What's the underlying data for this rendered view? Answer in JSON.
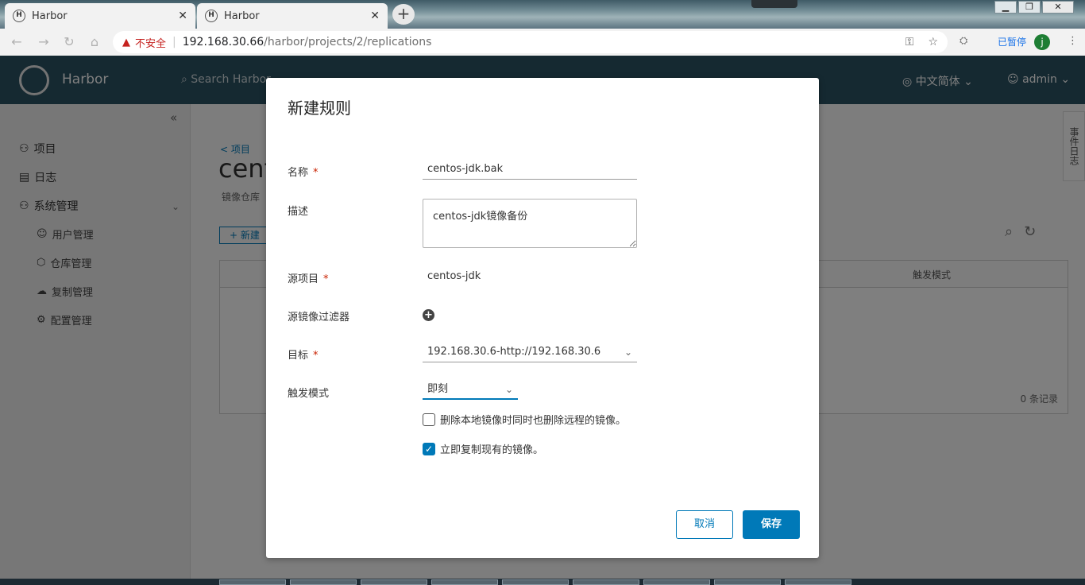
{
  "browser": {
    "tabs": [
      {
        "title": "Harbor",
        "close": "✕"
      },
      {
        "title": "Harbor",
        "close": "✕"
      }
    ],
    "new_tab": "+",
    "window_controls": {
      "minimize": "▁",
      "restore": "❐",
      "close": "✕"
    },
    "security_label": "不安全",
    "url_host": "192.168.30.66",
    "url_path": "/harbor/projects/2/replications",
    "ext_label": "已暂停",
    "profile_initial": "j"
  },
  "header": {
    "brand": "Harbor",
    "search_placeholder": "Search Harbor...",
    "language": "中文简体",
    "user": "admin"
  },
  "sidebar": {
    "items": [
      {
        "label": "项目"
      },
      {
        "label": "日志"
      },
      {
        "label": "系统管理"
      }
    ],
    "sub_items": [
      {
        "label": "用户管理"
      },
      {
        "label": "仓库管理"
      },
      {
        "label": "复制管理"
      },
      {
        "label": "配置管理"
      }
    ]
  },
  "main": {
    "back_link": "< 项目",
    "project_title": "centos-jdk",
    "project_sub": "镜像仓库",
    "new_button": "+ 新建",
    "grid_trigger_col": "触发模式",
    "grid_footer": "0 条记录",
    "side_tab": "事件日志"
  },
  "modal": {
    "title": "新建规则",
    "name_label": "名称",
    "name_value": "centos-jdk.bak",
    "desc_label": "描述",
    "desc_value": "centos-jdk镜像备份",
    "source_project_label": "源项目",
    "source_project_value": "centos-jdk",
    "filter_label": "源镜像过滤器",
    "target_label": "目标",
    "target_value": "192.168.30.6-http://192.168.30.6",
    "trigger_label": "触发模式",
    "trigger_value": "即刻",
    "delete_remote_label": "删除本地镜像时同时也删除远程的镜像。",
    "delete_remote_checked": false,
    "replicate_existing_label": "立即复制现有的镜像。",
    "replicate_existing_checked": true,
    "required_mark": "*",
    "cancel": "取消",
    "save": "保存"
  },
  "colors": {
    "header_bg": "#2b5262",
    "accent": "#0079b8",
    "required": "#c92100",
    "insecure": "#c5221f"
  }
}
